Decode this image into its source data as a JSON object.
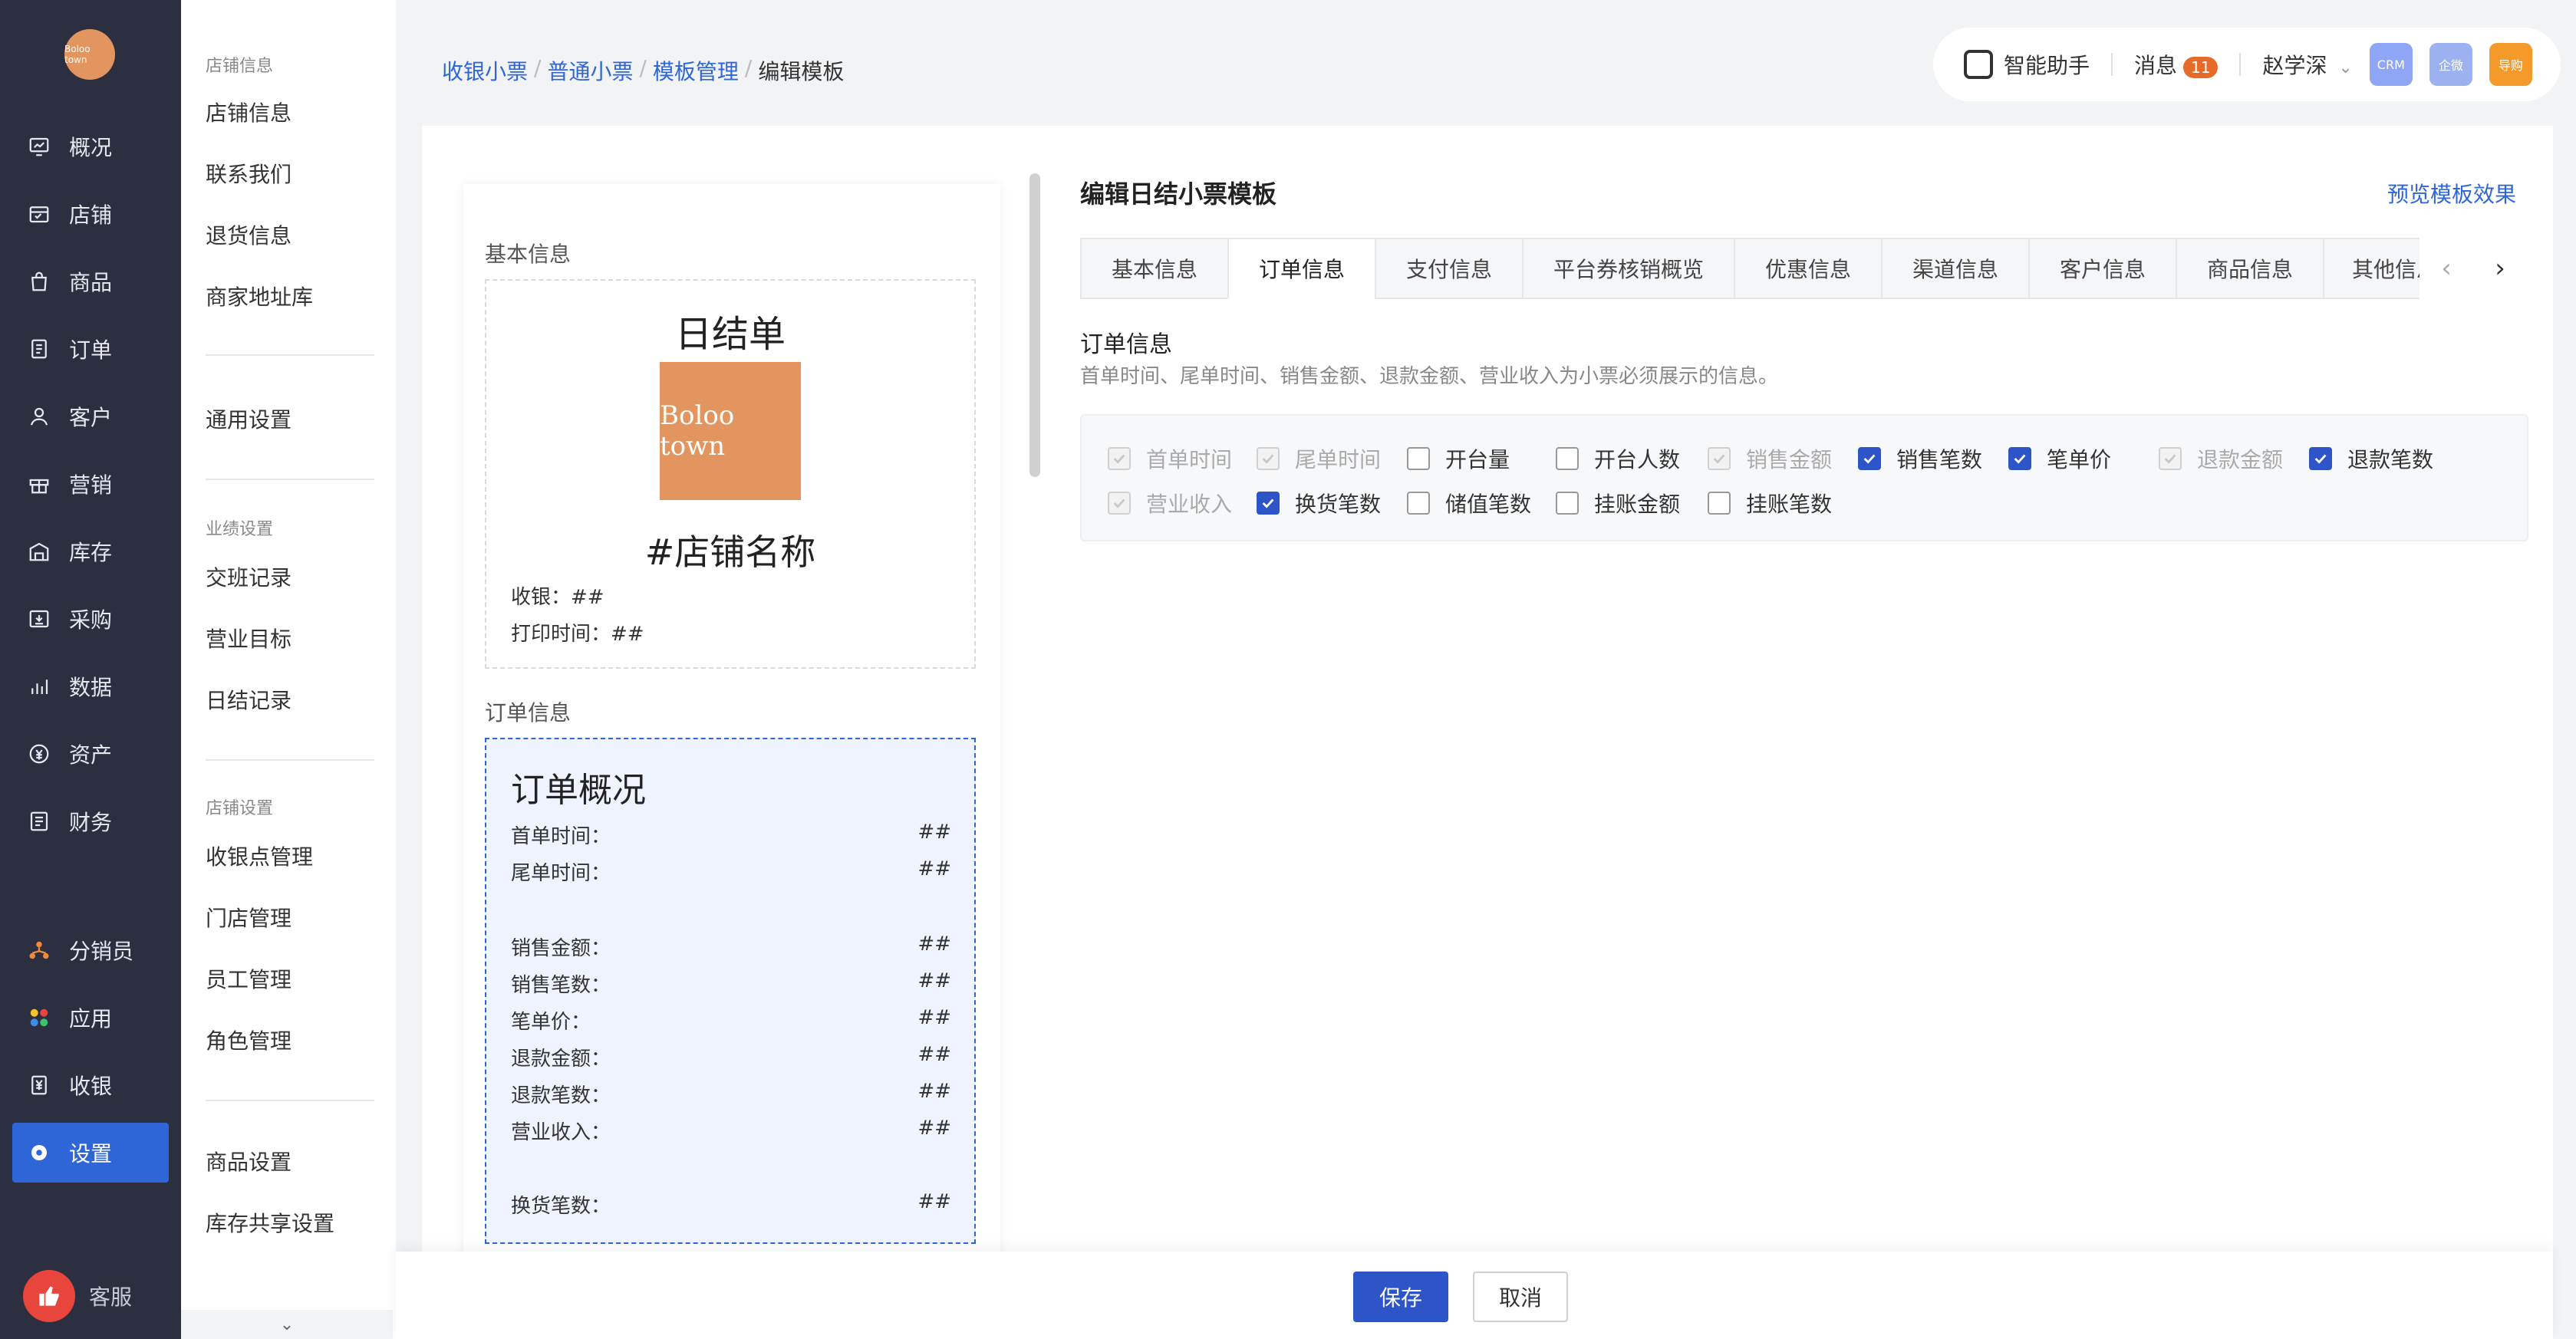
{
  "logo_text": "Boloo town",
  "nav": {
    "items": [
      {
        "label": "概况",
        "icon": "overview-icon"
      },
      {
        "label": "店铺",
        "icon": "store-icon"
      },
      {
        "label": "商品",
        "icon": "bag-icon"
      },
      {
        "label": "订单",
        "icon": "order-icon"
      },
      {
        "label": "客户",
        "icon": "user-icon"
      },
      {
        "label": "营销",
        "icon": "gift-icon"
      },
      {
        "label": "库存",
        "icon": "warehouse-icon"
      },
      {
        "label": "采购",
        "icon": "purchase-icon"
      },
      {
        "label": "数据",
        "icon": "chart-icon"
      },
      {
        "label": "资产",
        "icon": "asset-icon"
      },
      {
        "label": "财务",
        "icon": "finance-icon"
      },
      {
        "label": "分销员",
        "icon": "distributor-icon"
      },
      {
        "label": "应用",
        "icon": "apps-icon"
      },
      {
        "label": "收银",
        "icon": "cashier-icon"
      },
      {
        "label": "设置",
        "icon": "gear-icon"
      }
    ],
    "active": "设置",
    "kefu": "客服"
  },
  "submenu": {
    "group1": "店铺信息",
    "g1_items": [
      "店铺信息",
      "联系我们",
      "退货信息",
      "商家地址库"
    ],
    "general": "通用设置",
    "group2": "业绩设置",
    "g2_items": [
      "交班记录",
      "营业目标",
      "日结记录"
    ],
    "group3": "店铺设置",
    "g3_items": [
      "收银点管理",
      "门店管理",
      "员工管理",
      "角色管理"
    ],
    "g4_items": [
      "商品设置",
      "库存共享设置"
    ],
    "expand": "⌄"
  },
  "breadcrumb": [
    "收银小票",
    "普通小票",
    "模板管理",
    "编辑模板"
  ],
  "topbar": {
    "assistant": "智能助手",
    "messages": "消息",
    "message_count": "11",
    "user": "赵学深",
    "apps": [
      {
        "label": "CRM",
        "color": "#8ea6f5"
      },
      {
        "label": "企微",
        "color": "#9bb1f0"
      },
      {
        "label": "导购",
        "color": "#f39a2b"
      }
    ]
  },
  "receipt": {
    "basic_title": "基本信息",
    "daily_title": "日结单",
    "logo_text": "Boloo town",
    "store_name": "#店铺名称",
    "cashier": "收银：##",
    "print_time": "打印时间：##",
    "order_title": "订单信息",
    "order_heading": "订单概况",
    "rows": [
      {
        "k": "首单时间：",
        "v": "##"
      },
      {
        "k": "尾单时间：",
        "v": "##"
      },
      {
        "k": "销售金额：",
        "v": "##"
      },
      {
        "k": "销售笔数：",
        "v": "##"
      },
      {
        "k": "笔单价：",
        "v": "##"
      },
      {
        "k": "退款金额：",
        "v": "##"
      },
      {
        "k": "退款笔数：",
        "v": "##"
      },
      {
        "k": "营业收入：",
        "v": "##"
      },
      {
        "k": "换货笔数：",
        "v": "##"
      }
    ]
  },
  "editor": {
    "title": "编辑日结小票模板",
    "preview": "预览模板效果",
    "tabs": [
      "基本信息",
      "订单信息",
      "支付信息",
      "平台券核销概览",
      "优惠信息",
      "渠道信息",
      "客户信息",
      "商品信息",
      "其他信息"
    ],
    "active_tab": "订单信息",
    "section_title": "订单信息",
    "section_desc": "首单时间、尾单时间、销售金额、退款金额、营业收入为小票必须展示的信息。",
    "options": [
      {
        "label": "首单时间",
        "state": "disabled"
      },
      {
        "label": "尾单时间",
        "state": "disabled"
      },
      {
        "label": "开台量",
        "state": "off"
      },
      {
        "label": "开台人数",
        "state": "off"
      },
      {
        "label": "销售金额",
        "state": "disabled"
      },
      {
        "label": "销售笔数",
        "state": "on"
      },
      {
        "label": "笔单价",
        "state": "on"
      },
      {
        "label": "退款金额",
        "state": "disabled"
      },
      {
        "label": "退款笔数",
        "state": "on"
      },
      {
        "label": "营业收入",
        "state": "disabled"
      },
      {
        "label": "换货笔数",
        "state": "on"
      },
      {
        "label": "储值笔数",
        "state": "off"
      },
      {
        "label": "挂账金额",
        "state": "off"
      },
      {
        "label": "挂账笔数",
        "state": "off"
      }
    ]
  },
  "footer": {
    "save": "保存",
    "cancel": "取消"
  }
}
